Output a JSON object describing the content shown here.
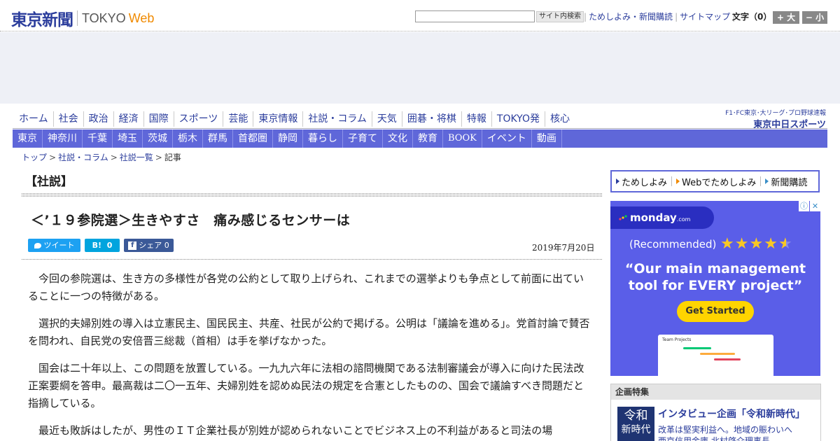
{
  "header": {
    "logo_jp": "東京新聞",
    "logo_en": "TOKYO",
    "logo_web": "Web",
    "search_placeholder": "",
    "search_button": "サイト内検索",
    "links": [
      "ためしよみ・新聞購読",
      "サイトマップ"
    ],
    "font_size_label": "文字（0）",
    "font_bigger": "+ 大",
    "font_smaller": "− 小"
  },
  "nav": {
    "main": [
      "ホーム",
      "社会",
      "政治",
      "経済",
      "国際",
      "スポーツ",
      "芸能",
      "東京情報",
      "社説・コラム",
      "天気",
      "囲碁・将棋",
      "特報",
      "TOKYO発",
      "核心"
    ],
    "regional": [
      "東京",
      "神奈川",
      "千葉",
      "埼玉",
      "茨城",
      "栃木",
      "群馬",
      "首都圏",
      "静岡",
      "暮らし",
      "子育て",
      "文化",
      "教育",
      "BOOK",
      "イベント",
      "動画"
    ],
    "chunichi_small": "F1･FC東京･大リーグ･プロ野球速報",
    "chunichi_name": "東京中日スポーツ"
  },
  "breadcrumb": [
    "トップ",
    "社説・コラム",
    "社説一覧",
    "記事"
  ],
  "article": {
    "section": "【社説】",
    "headline": "＜’１９参院選＞生きやすさ　痛み感じるセンサーは",
    "date": "2019年7月20日",
    "share": {
      "tweet": "ツイート",
      "hatena_count": "0",
      "fb_label": "シェア",
      "fb_count": "0"
    },
    "paragraphs": [
      "今回の参院選は、生き方の多様性が各党の公約として取り上げられ、これまでの選挙よりも争点として前面に出ていることに一つの特徴がある。",
      "選択的夫婦別姓の導入は立憲民主、国民民主、共産、社民が公約で掲げる。公明は「議論を進める」。党首討論で賛否を問われ、自民党の安倍晋三総裁（首相）は手を挙げなかった。",
      "国会は二十年以上、この問題を放置している。一九九六年に法相の諮問機関である法制審議会が導入に向けた民法改正案要綱を答申。最高裁は二〇一五年、夫婦別姓を認めぬ民法の規定を合憲としたものの、国会で議論すべき問題だと指摘している。",
      "最近も敗訴はしたが、男性のＩＴ企業社長が別姓が認められないことでビジネス上の不利益があると司法の場"
    ]
  },
  "sidebar": {
    "links": [
      "ためしよみ",
      "Webでためしよみ",
      "新聞購読"
    ],
    "ad": {
      "brand": "monday",
      "brand_suffix": ".com",
      "recommended": "(Recommended)",
      "headline": "“Our main management tool for EVERY project”",
      "cta": "Get Started",
      "shot_title": "Team Projects"
    },
    "feature": {
      "heading": "企画特集",
      "image_line1": "令和",
      "image_line2": "新時代",
      "title": "インタビュー企画「令和新時代」",
      "sub1": "改革は堅実利益へ。地域の賑わいへ",
      "sub2": "西京信用金庫 北村啓介理事長"
    }
  },
  "colors": {
    "brand_blue": "#2b3d9c",
    "nav_purple": "#5f67d9",
    "web_orange": "#f08a00",
    "twitter": "#1da1f2",
    "hatena": "#00a4de",
    "facebook": "#3b5998",
    "ad_bg": "#5a5ee8",
    "ad_cta": "#ffd400"
  }
}
